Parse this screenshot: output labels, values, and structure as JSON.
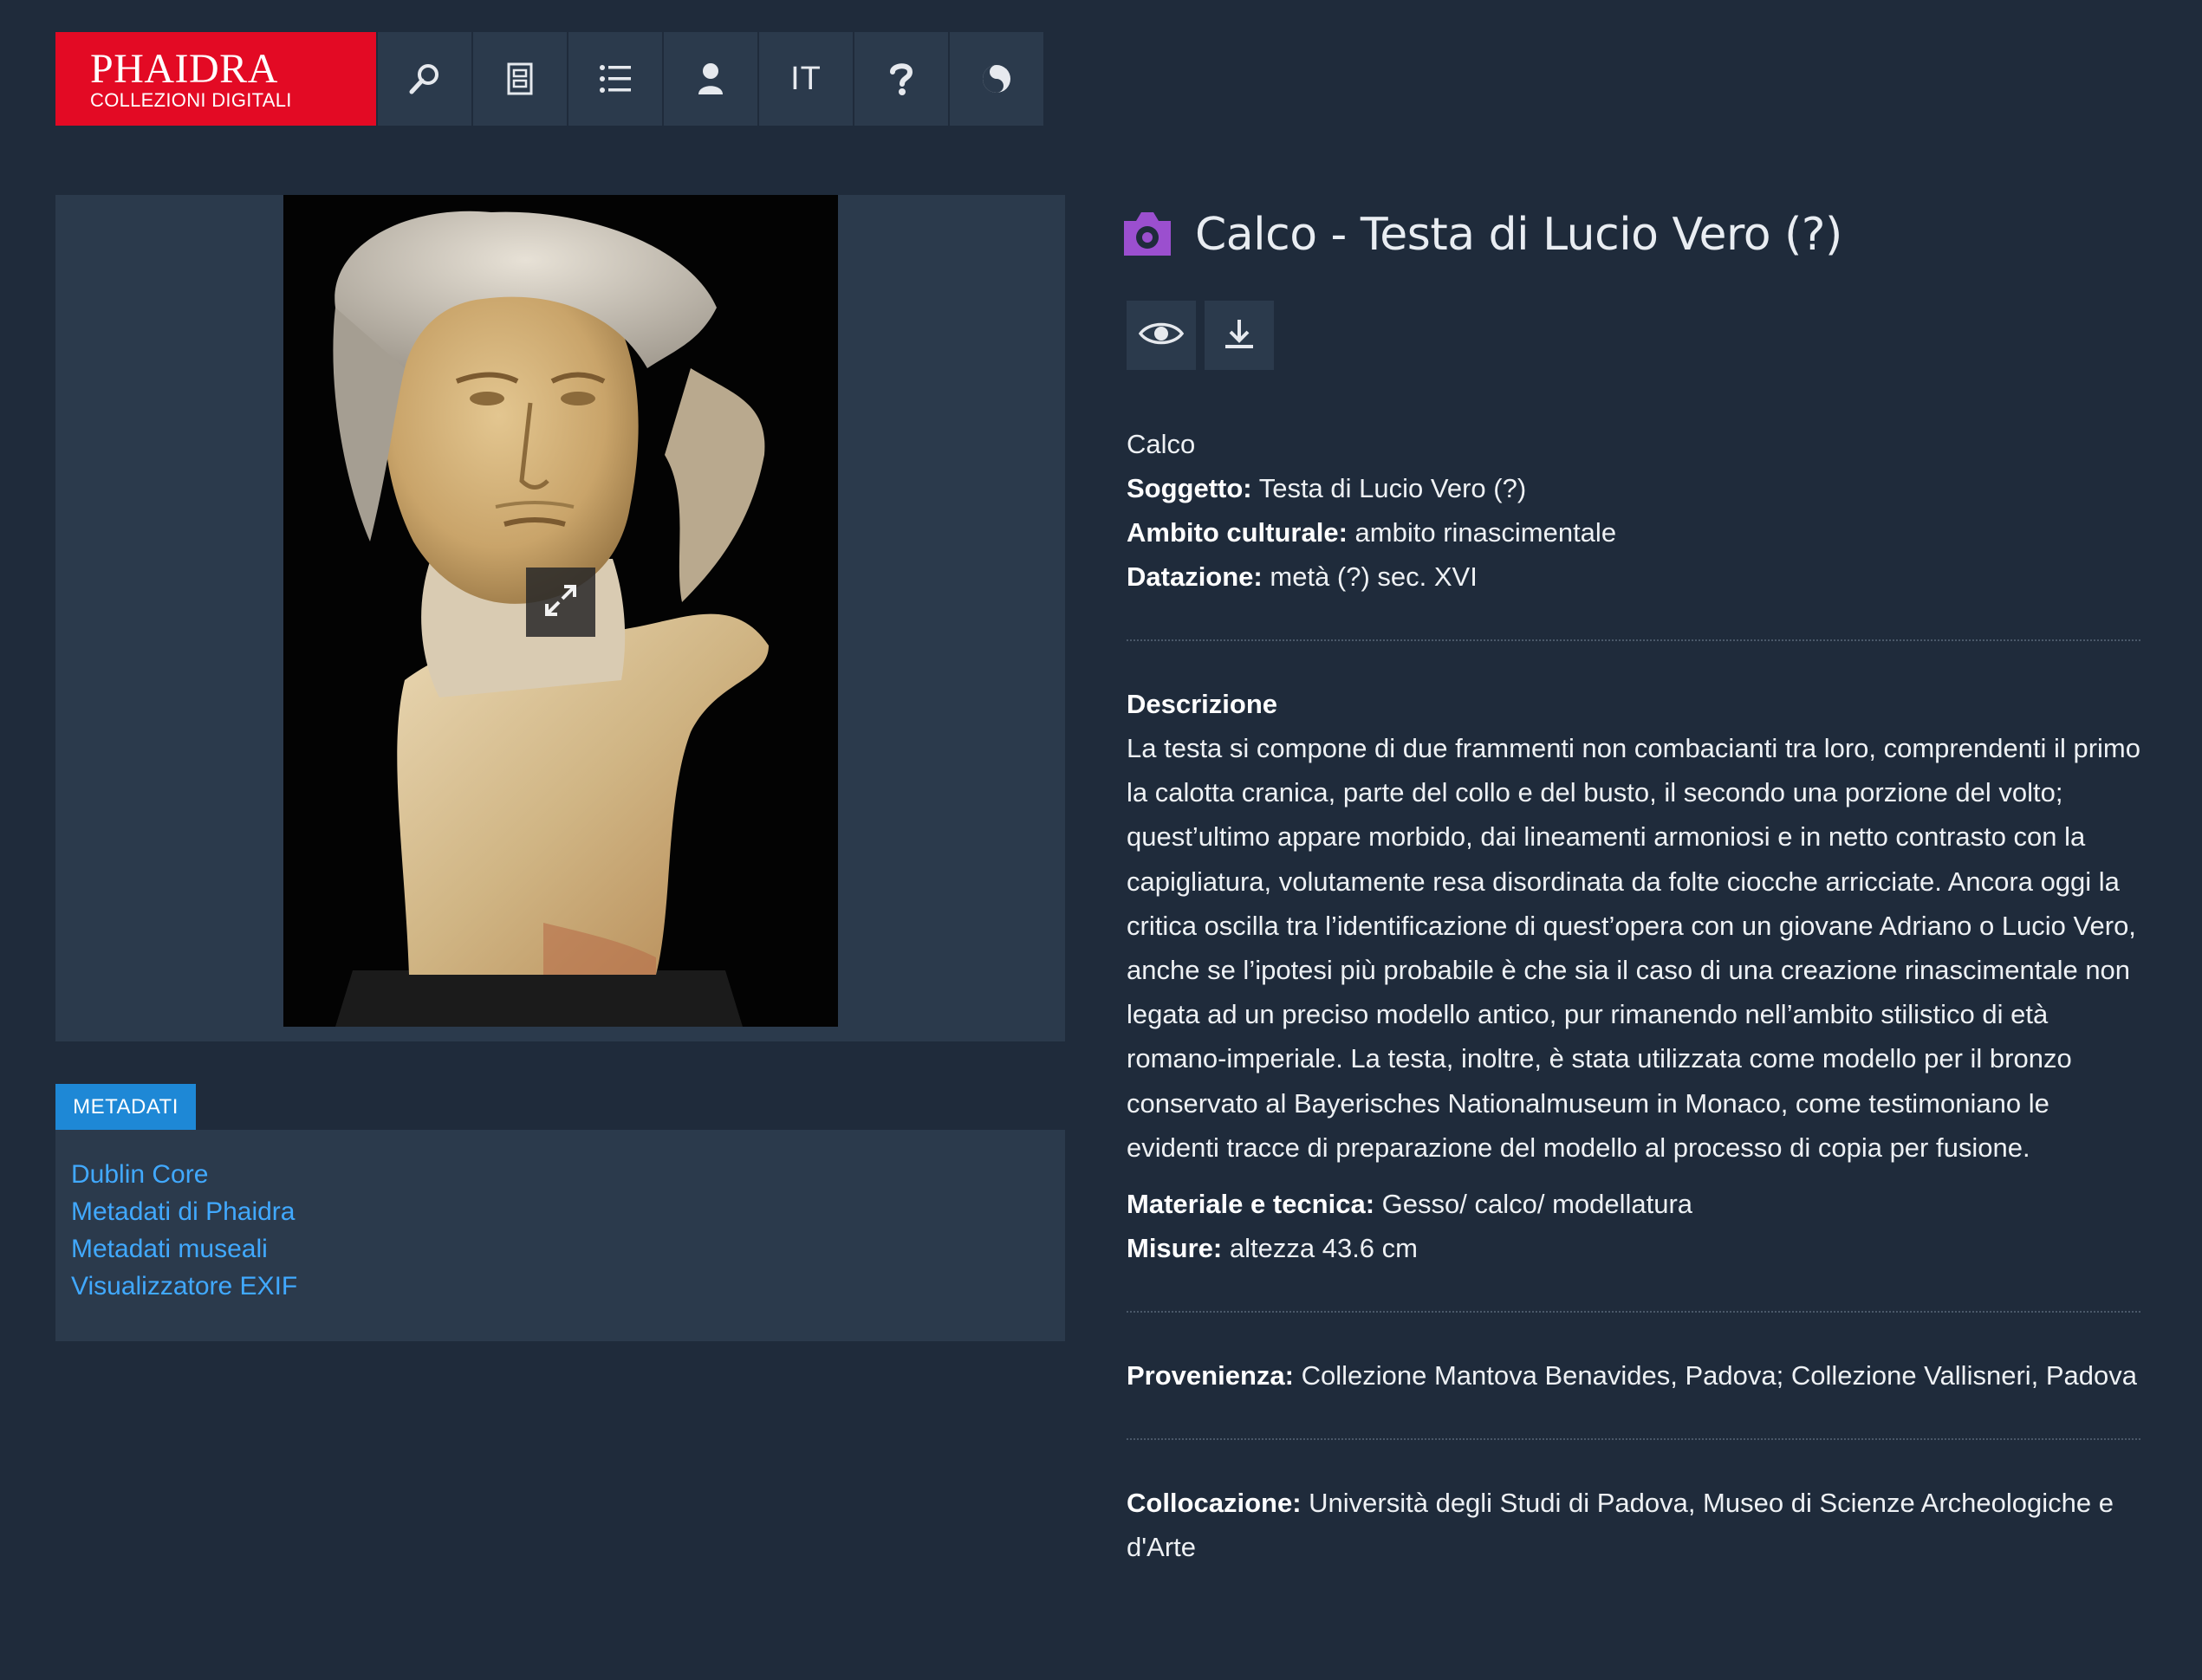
{
  "brand": {
    "line1": "PHAIDRA",
    "line2": "COLLEZIONI DIGITALI",
    "color": "#e30a24"
  },
  "nav": {
    "search": "search-icon",
    "docs": "document-icon",
    "list": "list-icon",
    "user": "user-icon",
    "lang": "IT",
    "help": "help-icon",
    "theme": "contrast-icon"
  },
  "object": {
    "title": "Calco - Testa di Lucio Vero (?)",
    "type_icon": "camera-icon",
    "type_icon_color": "#9b4fcf",
    "actions": [
      "view-icon",
      "download-icon"
    ]
  },
  "summary": {
    "type": "Calco",
    "soggetto_label": "Soggetto:",
    "soggetto": "Testa di Lucio Vero (?)",
    "ambito_label": "Ambito culturale:",
    "ambito": "ambito rinascimentale",
    "datazione_label": "Datazione:",
    "datazione": "metà (?) sec. XVI"
  },
  "description": {
    "label": "Descrizione",
    "text": "La testa si compone di due frammenti non combacianti tra loro, comprendenti il primo la calotta cranica, parte del collo e del busto, il secondo una porzione del volto; quest’ultimo appare morbido, dai lineamenti armoniosi e in netto contrasto con la capigliatura, volutamente resa disordinata da folte ciocche arricciate. Ancora oggi la critica oscilla tra l’identificazione di quest’opera con un giovane Adriano o Lucio Vero, anche se l’ipotesi più probabile è che sia il caso di una creazione rinascimentale non legata ad un preciso modello antico, pur rimanendo nell’ambito stilistico di età romano-imperiale. La testa, inoltre, è stata utilizzata come modello per il bronzo conservato al Bayerisches Nationalmuseum in Monaco, come testimoniano le evidenti tracce di preparazione del modello al processo di copia per fusione.",
    "materiale_label": "Materiale e tecnica:",
    "materiale": "Gesso/ calco/ modellatura",
    "misure_label": "Misure:",
    "misure": "altezza 43.6 cm"
  },
  "provenienza": {
    "label": "Provenienza:",
    "value": "Collezione Mantova Benavides, Padova; Collezione Vallisneri, Padova"
  },
  "collocazione": {
    "label": "Collocazione:",
    "value": "Università degli Studi di Padova, Museo di Scienze Archeologiche e d'Arte"
  },
  "metadata": {
    "tab": "METADATI",
    "links": [
      "Dublin Core",
      "Metadati di Phaidra",
      "Metadati museali",
      "Visualizzatore EXIF"
    ]
  },
  "image": {
    "expand_icon": "expand-icon"
  }
}
